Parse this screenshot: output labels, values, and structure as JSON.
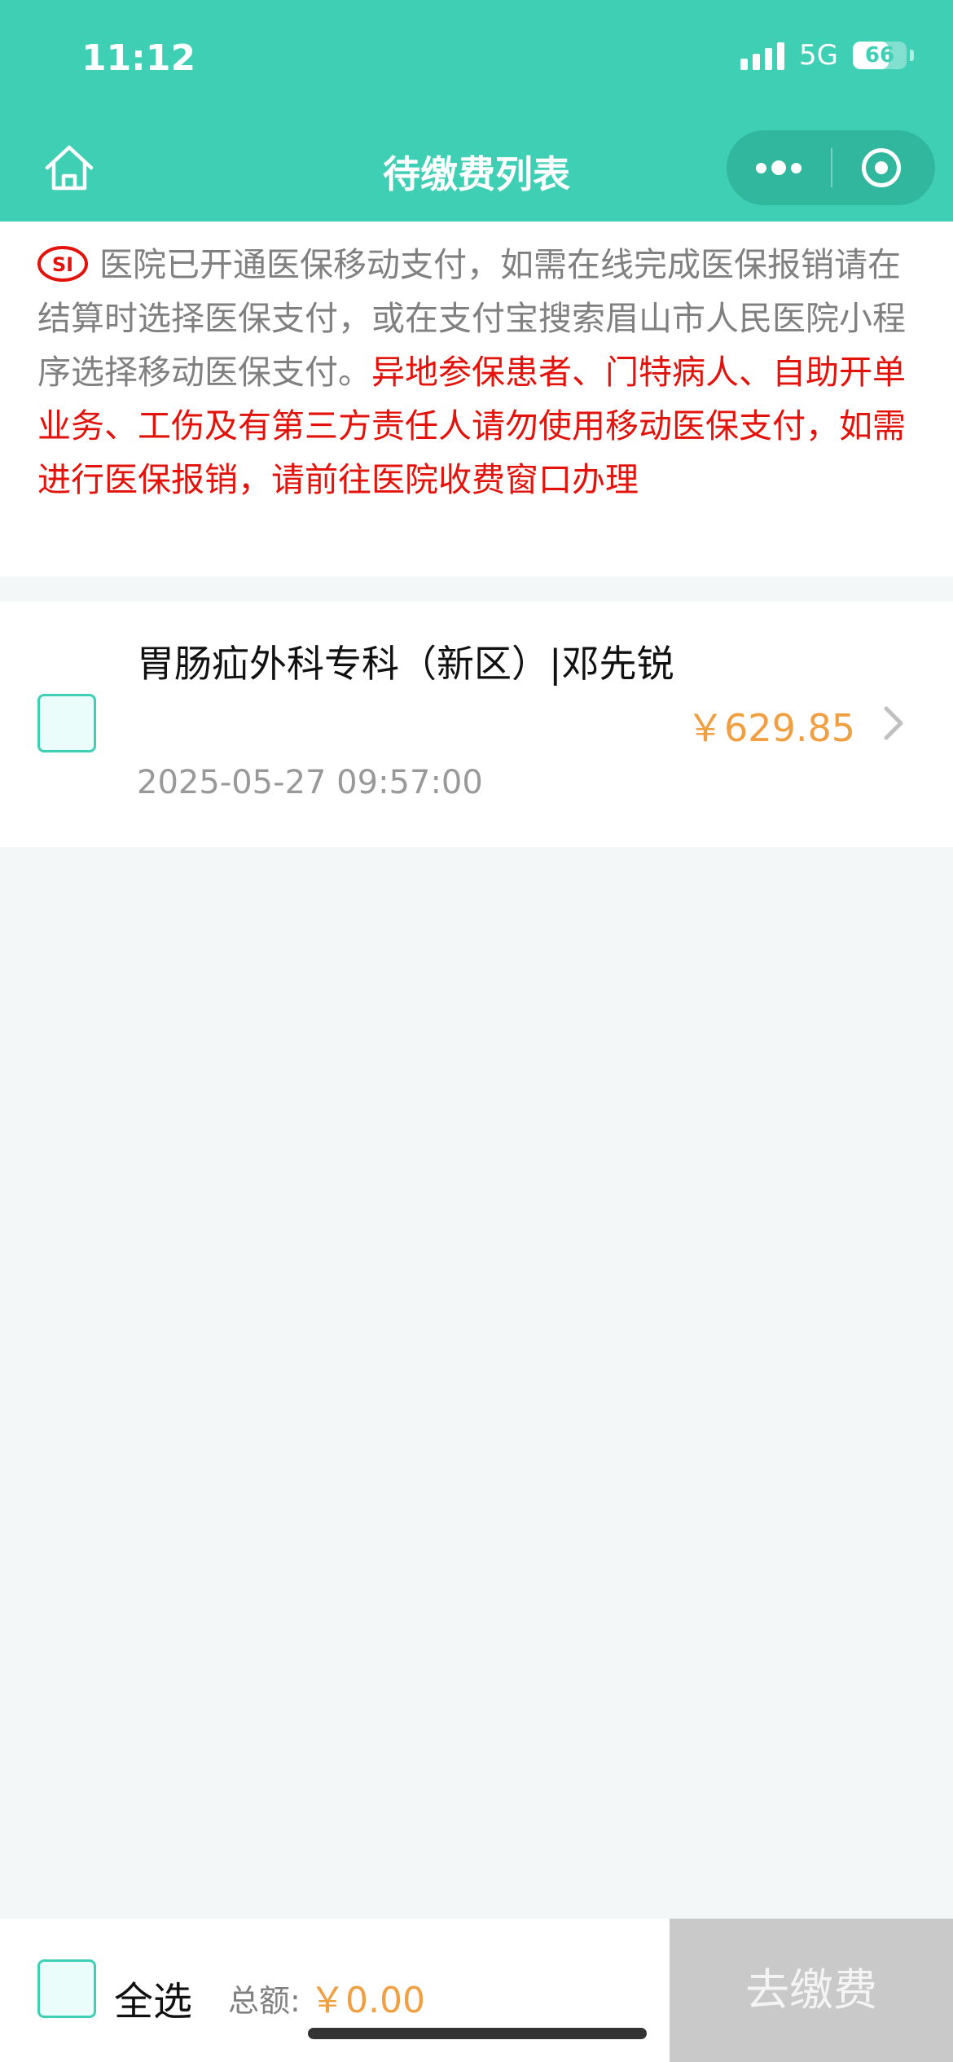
{
  "status_bar": {
    "time": "11:12",
    "network": "5G",
    "battery": "66",
    "battery_level": 0.66
  },
  "nav": {
    "title": "待缴费列表",
    "home_icon": "home-icon",
    "more_icon": "more-dots-icon",
    "close_icon": "target-icon"
  },
  "notice": {
    "logo_text": "SI",
    "gray_text": "医院已开通医保移动支付，如需在线完成医保报销请在结算时选择医保支付，或在支付宝搜索眉山市人民医院小程序选择移动医保支付。",
    "red_text": "异地参保患者、门特病人、自助开单业务、工伤及有第三方责任人请勿使用移动医保支付，如需进行医保报销，请前往医院收费窗口办理"
  },
  "items": [
    {
      "title": "胃肠疝外科专科（新区）|邓先锐",
      "date": "2025-05-27 09:57:00",
      "amount": "￥629.85",
      "checked": false
    }
  ],
  "footer": {
    "select_all": "全选",
    "total_label": "总额:",
    "total_amount": "￥0.00",
    "pay_button": "去缴费"
  },
  "colors": {
    "accent": "#3ecfb5",
    "price": "#f0a043",
    "warning": "#e3120b",
    "disabled": "#c9c9c9"
  }
}
